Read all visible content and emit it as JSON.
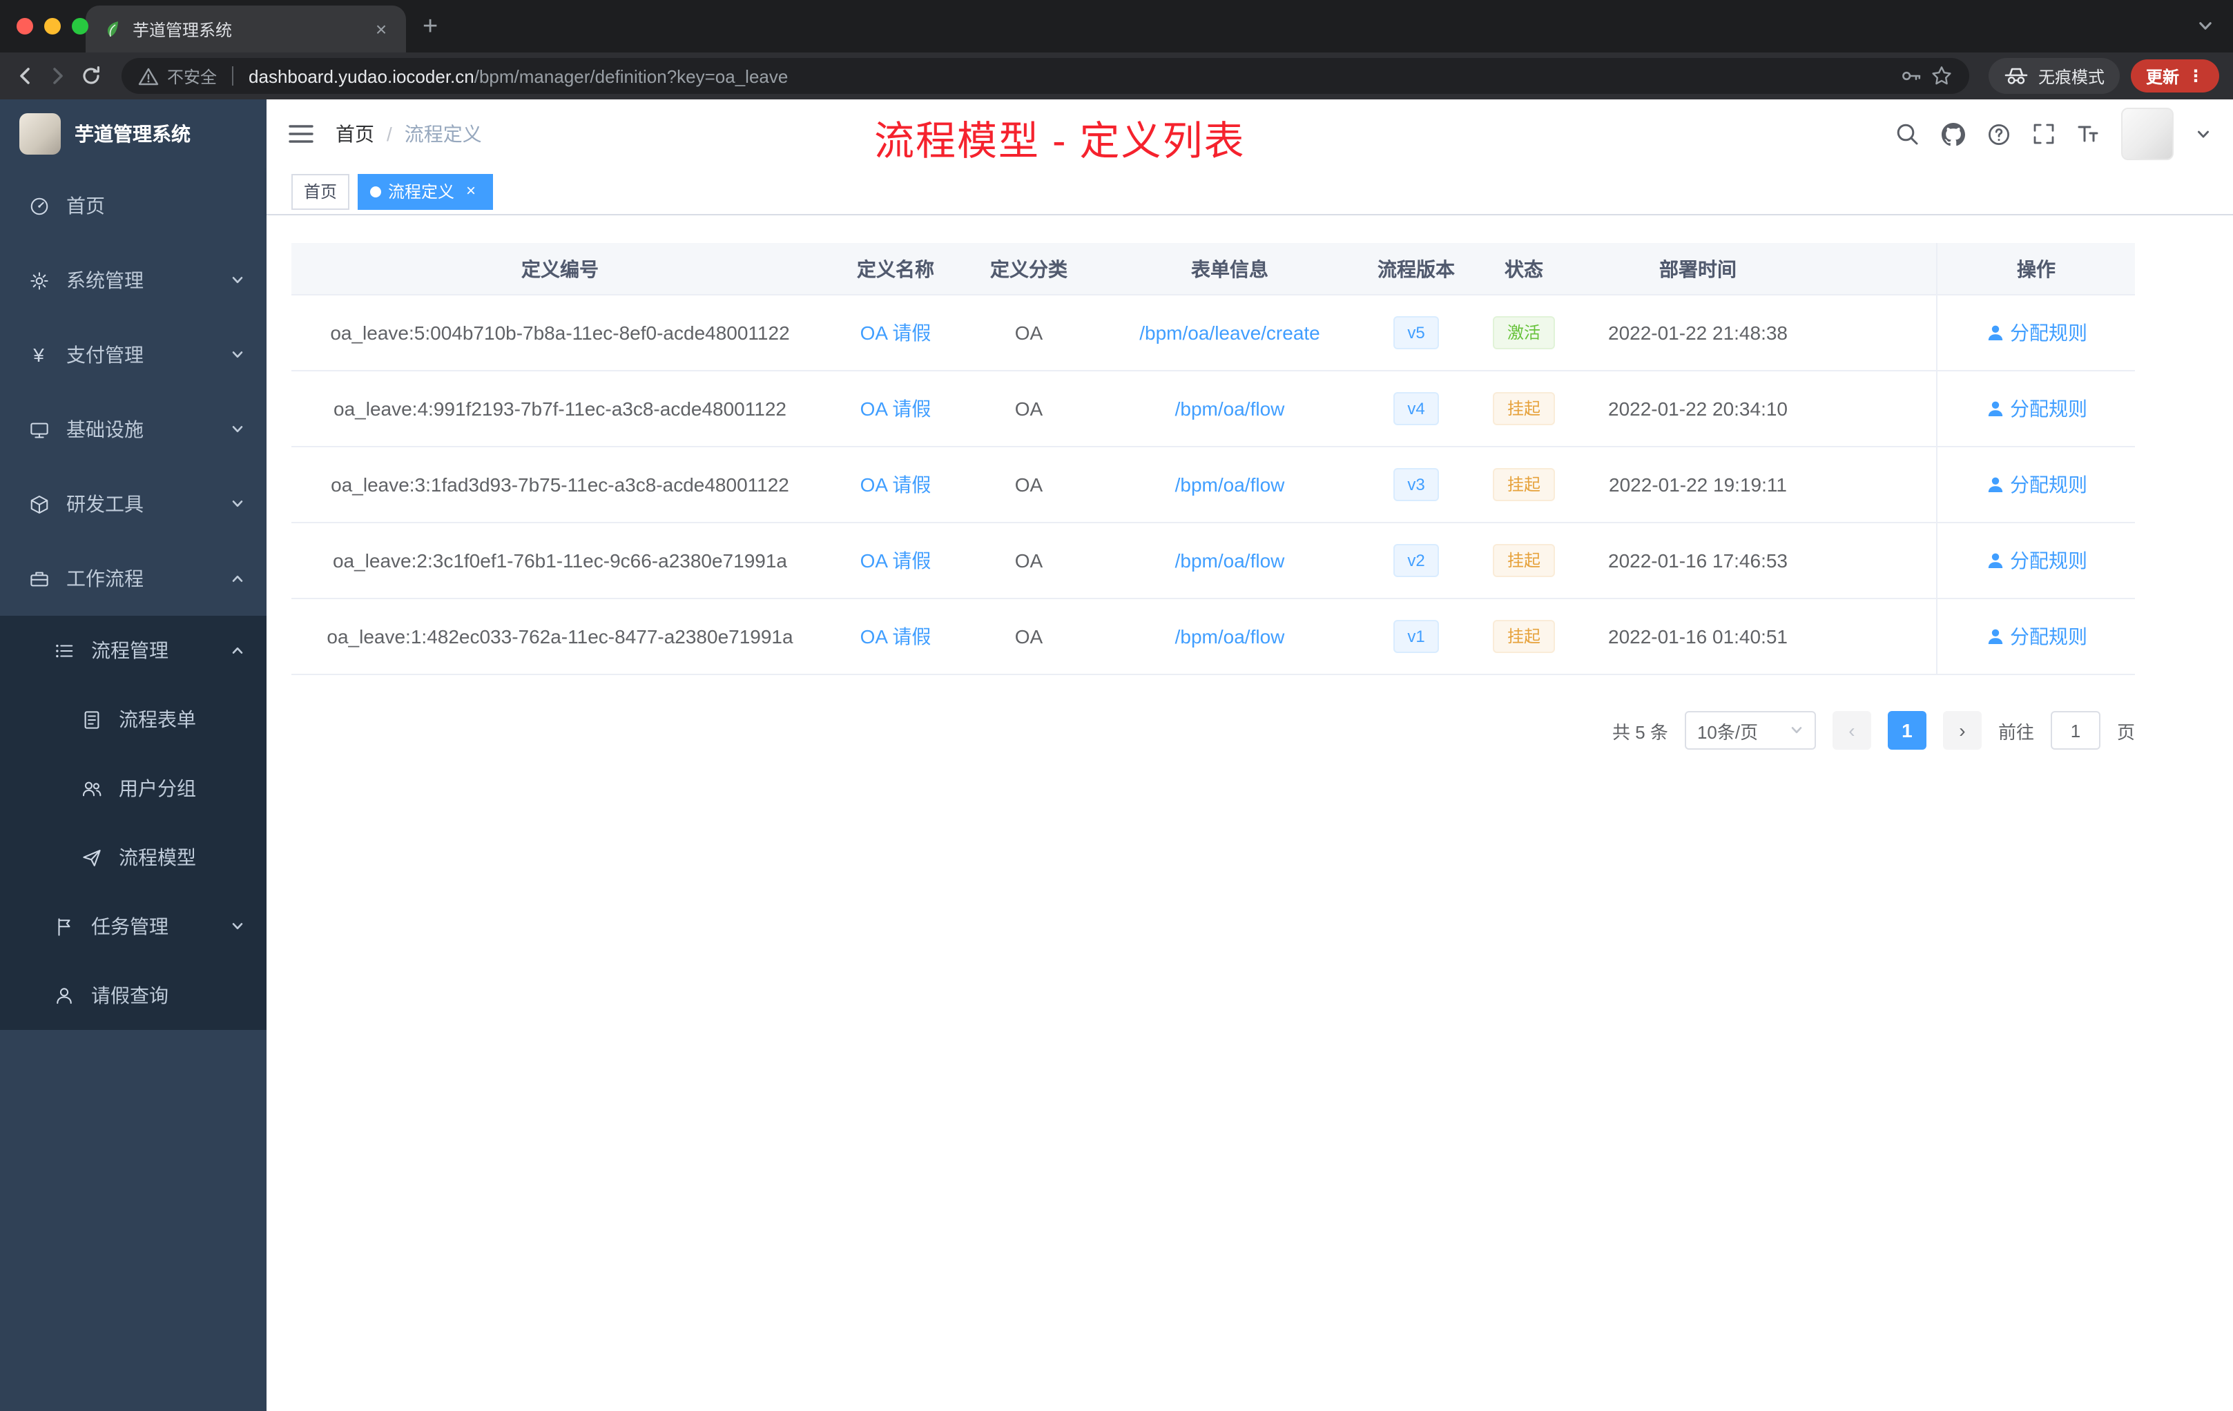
{
  "colors": {
    "accent": "#409eff",
    "success": "#67c23a",
    "warning": "#e6a23c",
    "annotation_red": "#f5222d",
    "sidebar_bg": "#304156",
    "sidebar_sub_bg": "#1f2d3d",
    "active_tag_bg": "#409eff"
  },
  "ui": {
    "close": "×",
    "plus": "+",
    "kebab": "⋮",
    "yen": "¥",
    "slash": "/"
  },
  "browser": {
    "tab_title": "芋道管理系统",
    "security_label": "不安全",
    "url_domain": "dashboard.yudao.iocoder.cn",
    "url_path": "/bpm/manager/definition?key=oa_leave",
    "incognito_label": "无痕模式",
    "update_label": "更新"
  },
  "sidebar": {
    "logo_title": "芋道管理系统",
    "items": [
      {
        "label": "首页",
        "icon": "dashboard-icon"
      },
      {
        "label": "系统管理",
        "icon": "gear-icon"
      },
      {
        "label": "支付管理",
        "icon": "yen-icon"
      },
      {
        "label": "基础设施",
        "icon": "monitor-icon"
      },
      {
        "label": "研发工具",
        "icon": "cube-icon"
      },
      {
        "label": "工作流程",
        "icon": "briefcase-icon"
      },
      {
        "label": "流程管理",
        "icon": "list-icon"
      },
      {
        "label": "流程表单",
        "icon": "document-icon"
      },
      {
        "label": "用户分组",
        "icon": "user-group-icon"
      },
      {
        "label": "流程模型",
        "icon": "paper-plane-icon"
      },
      {
        "label": "任务管理",
        "icon": "flag-icon"
      },
      {
        "label": "请假查询",
        "icon": "person-icon"
      }
    ]
  },
  "header": {
    "breadcrumb_home": "首页",
    "breadcrumb_current": "流程定义",
    "annotation": "流程模型 - 定义列表"
  },
  "tags": {
    "home": "首页",
    "active": "流程定义"
  },
  "table": {
    "columns": [
      "定义编号",
      "定义名称",
      "定义分类",
      "表单信息",
      "流程版本",
      "状态",
      "部署时间",
      "操作"
    ],
    "rows": [
      {
        "id": "oa_leave:5:004b710b-7b8a-11ec-8ef0-acde48001122",
        "name": "OA 请假",
        "category": "OA",
        "form": "/bpm/oa/leave/create",
        "version": "v5",
        "status": "激活",
        "status_type": "success",
        "time": "2022-01-22 21:48:38",
        "action": "分配规则"
      },
      {
        "id": "oa_leave:4:991f2193-7b7f-11ec-a3c8-acde48001122",
        "name": "OA 请假",
        "category": "OA",
        "form": "/bpm/oa/flow",
        "version": "v4",
        "status": "挂起",
        "status_type": "warning",
        "time": "2022-01-22 20:34:10",
        "action": "分配规则"
      },
      {
        "id": "oa_leave:3:1fad3d93-7b75-11ec-a3c8-acde48001122",
        "name": "OA 请假",
        "category": "OA",
        "form": "/bpm/oa/flow",
        "version": "v3",
        "status": "挂起",
        "status_type": "warning",
        "time": "2022-01-22 19:19:11",
        "action": "分配规则"
      },
      {
        "id": "oa_leave:2:3c1f0ef1-76b1-11ec-9c66-a2380e71991a",
        "name": "OA 请假",
        "category": "OA",
        "form": "/bpm/oa/flow",
        "version": "v2",
        "status": "挂起",
        "status_type": "warning",
        "time": "2022-01-16 17:46:53",
        "action": "分配规则"
      },
      {
        "id": "oa_leave:1:482ec033-762a-11ec-8477-a2380e71991a",
        "name": "OA 请假",
        "category": "OA",
        "form": "/bpm/oa/flow",
        "version": "v1",
        "status": "挂起",
        "status_type": "warning",
        "time": "2022-01-16 01:40:51",
        "action": "分配规则"
      }
    ]
  },
  "pagination": {
    "total": "共 5 条",
    "page_size": "10条/页",
    "prev": "‹",
    "page": "1",
    "next": "›",
    "goto_label": "前往",
    "goto_value": "1",
    "unit": "页"
  }
}
